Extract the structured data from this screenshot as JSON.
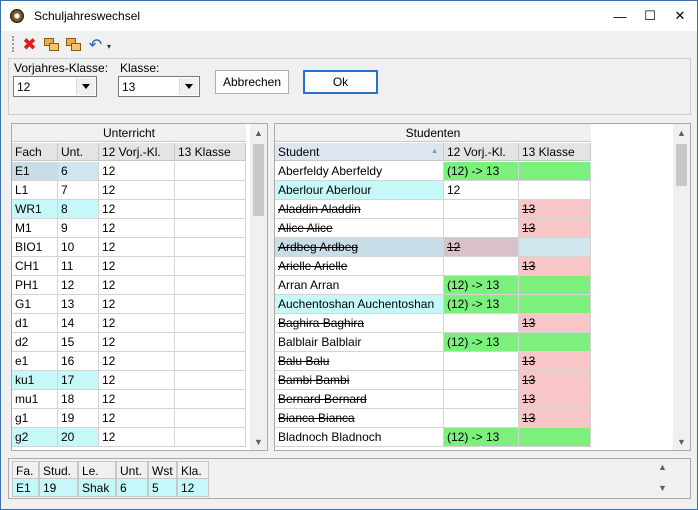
{
  "window": {
    "title": "Schuljahreswechsel",
    "min_glyph": "—",
    "max_glyph": "☐",
    "close_glyph": "✕"
  },
  "toolbar": {
    "delete_glyph": "✖",
    "undo_glyph": "↶",
    "dropdown_glyph": "▾"
  },
  "filters": {
    "prev_class_label": "Vorjahres-Klasse:",
    "prev_class_value": "12",
    "class_label": "Klasse:",
    "class_value": "13",
    "cancel_label": "Abbrechen",
    "ok_label": "Ok"
  },
  "unterricht": {
    "title": "Unterricht",
    "columns": [
      "Fach",
      "Unt.",
      "12 Vorj.-Kl.",
      "13 Klasse"
    ],
    "rows": [
      {
        "fach": "E1",
        "unt": "6",
        "vorj": "12",
        "klasse": ""
      },
      {
        "fach": "L1",
        "unt": "7",
        "vorj": "12",
        "klasse": ""
      },
      {
        "fach": "WR1",
        "unt": "8",
        "vorj": "12",
        "klasse": ""
      },
      {
        "fach": "M1",
        "unt": "9",
        "vorj": "12",
        "klasse": ""
      },
      {
        "fach": "BIO1",
        "unt": "10",
        "vorj": "12",
        "klasse": ""
      },
      {
        "fach": "CH1",
        "unt": "11",
        "vorj": "12",
        "klasse": ""
      },
      {
        "fach": "PH1",
        "unt": "12",
        "vorj": "12",
        "klasse": ""
      },
      {
        "fach": "G1",
        "unt": "13",
        "vorj": "12",
        "klasse": ""
      },
      {
        "fach": "d1",
        "unt": "14",
        "vorj": "12",
        "klasse": ""
      },
      {
        "fach": "d2",
        "unt": "15",
        "vorj": "12",
        "klasse": ""
      },
      {
        "fach": "e1",
        "unt": "16",
        "vorj": "12",
        "klasse": ""
      },
      {
        "fach": "ku1",
        "unt": "17",
        "vorj": "12",
        "klasse": ""
      },
      {
        "fach": "mu1",
        "unt": "18",
        "vorj": "12",
        "klasse": ""
      },
      {
        "fach": "g1",
        "unt": "19",
        "vorj": "12",
        "klasse": ""
      },
      {
        "fach": "g2",
        "unt": "20",
        "vorj": "12",
        "klasse": ""
      }
    ]
  },
  "studenten": {
    "title": "Studenten",
    "columns": [
      "Student",
      "12 Vorj.-Kl.",
      "13 Klasse"
    ],
    "sort_glyph": "▲",
    "rows": [
      {
        "name": "Aberfeldy Aberfeldy",
        "vorj": "(12)  ->  13",
        "klasse": ""
      },
      {
        "name": "Aberlour Aberlour",
        "vorj": "12",
        "klasse": ""
      },
      {
        "name": "Aladdin Aladdin",
        "vorj": "",
        "klasse": "13"
      },
      {
        "name": "Alice Alice",
        "vorj": "",
        "klasse": "13"
      },
      {
        "name": "Ardbeg Ardbeg",
        "vorj": "12",
        "klasse": ""
      },
      {
        "name": "Arielle Arielle",
        "vorj": "",
        "klasse": "13"
      },
      {
        "name": "Arran Arran",
        "vorj": "(12)  ->  13",
        "klasse": ""
      },
      {
        "name": "Auchentoshan Auchentoshan",
        "vorj": "(12)  ->  13",
        "klasse": ""
      },
      {
        "name": "Baghira Baghira",
        "vorj": "",
        "klasse": "13"
      },
      {
        "name": "Balblair Balblair",
        "vorj": "(12)  ->  13",
        "klasse": ""
      },
      {
        "name": "Balu Balu",
        "vorj": "",
        "klasse": "13"
      },
      {
        "name": "Bambi Bambi",
        "vorj": "",
        "klasse": "13"
      },
      {
        "name": "Bernard Bernard",
        "vorj": "",
        "klasse": "13"
      },
      {
        "name": "Bianca Bianca",
        "vorj": "",
        "klasse": "13"
      },
      {
        "name": "Bladnoch Bladnoch",
        "vorj": "(12)  ->  13",
        "klasse": ""
      }
    ]
  },
  "details": {
    "columns": [
      "Fa.",
      "Stud.",
      "Le.",
      "Unt.",
      "Wst",
      "Kla."
    ],
    "values": [
      "E1",
      "19",
      "Shak",
      "6",
      "5",
      "12"
    ]
  },
  "scroll": {
    "up_glyph": "▲",
    "down_glyph": "▼"
  },
  "colors": {
    "accent": "#2a6fd0",
    "green": "#7cf07c",
    "pink": "#f8c6c6",
    "cyan": "#c6f8fa"
  }
}
